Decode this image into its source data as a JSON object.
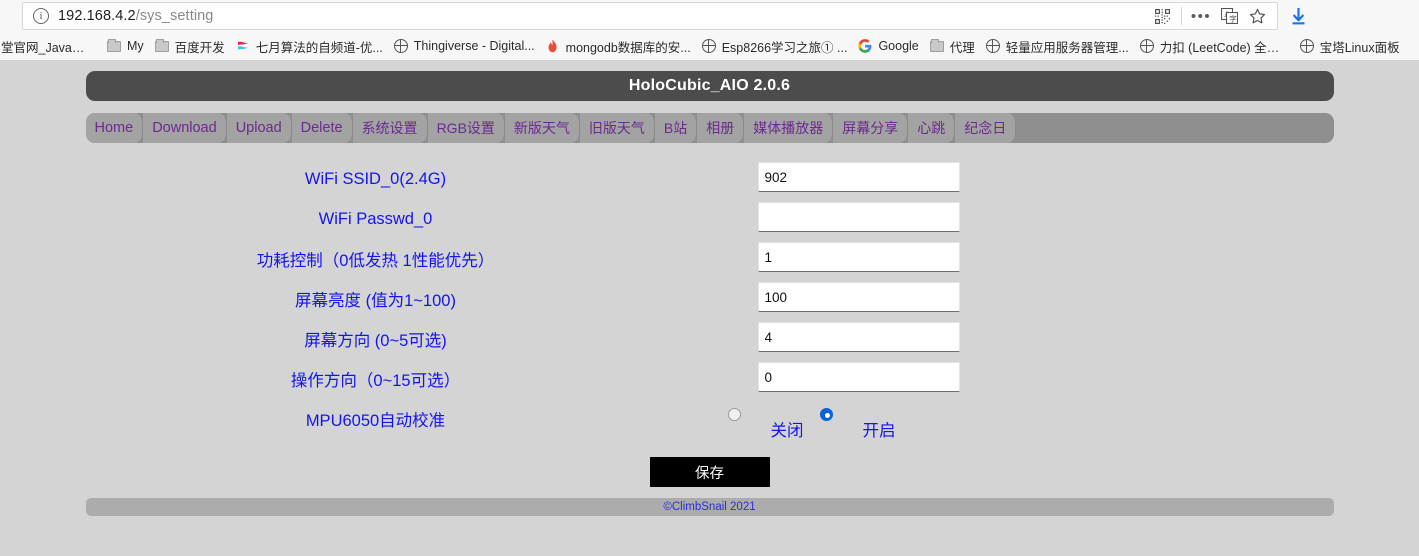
{
  "browser": {
    "url_host": "192.168.4.2",
    "url_path": "/sys_setting",
    "info_icon": "info-circle-icon",
    "toolbar_icons": {
      "qr": "qr-code-icon",
      "menu": "ellipsis-menu-icon",
      "translate": "translate-icon",
      "bookmark": "star-bookmark-icon",
      "download": "download-arrow-icon"
    },
    "bookmarks": [
      {
        "label": "堂官网_Java视频...",
        "icon": "page-icon"
      },
      {
        "label": "My",
        "icon": "folder-icon"
      },
      {
        "label": "百度开发",
        "icon": "folder-icon"
      },
      {
        "label": "七月算法的自频道-优...",
        "icon": "youku-icon"
      },
      {
        "label": "Thingiverse - Digital...",
        "icon": "globe-icon"
      },
      {
        "label": "mongodb数据库的安...",
        "icon": "flame-icon"
      },
      {
        "label": "Esp8266学习之旅① ...",
        "icon": "globe-icon"
      },
      {
        "label": "Google",
        "icon": "google-icon"
      },
      {
        "label": "代理",
        "icon": "folder-icon"
      },
      {
        "label": "轻量应用服务器管理...",
        "icon": "globe-icon"
      },
      {
        "label": "力扣 (LeetCode) 全球...",
        "icon": "globe-icon"
      },
      {
        "label": "宝塔Linux面板",
        "icon": "globe-icon"
      }
    ]
  },
  "page": {
    "title": "HoloCubic_AIO 2.0.6",
    "nav": [
      {
        "label": "Home",
        "cjk": false
      },
      {
        "label": "Download",
        "cjk": false
      },
      {
        "label": "Upload",
        "cjk": false
      },
      {
        "label": "Delete",
        "cjk": false
      },
      {
        "label": "系统设置",
        "cjk": true
      },
      {
        "label": "RGB设置",
        "cjk": true
      },
      {
        "label": "新版天气",
        "cjk": true
      },
      {
        "label": "旧版天气",
        "cjk": true
      },
      {
        "label": "B站",
        "cjk": true
      },
      {
        "label": "相册",
        "cjk": true
      },
      {
        "label": "媒体播放器",
        "cjk": true
      },
      {
        "label": "屏幕分享",
        "cjk": true
      },
      {
        "label": "心跳",
        "cjk": true
      },
      {
        "label": "纪念日",
        "cjk": true
      }
    ],
    "fields": [
      {
        "label": "WiFi SSID_0(2.4G)",
        "value": "902"
      },
      {
        "label": "WiFi Passwd_0",
        "value": ""
      },
      {
        "label": "功耗控制（0低发热 1性能优先）",
        "value": "1"
      },
      {
        "label": "屏幕亮度 (值为1~100)",
        "value": "100"
      },
      {
        "label": "屏幕方向 (0~5可选)",
        "value": "4"
      },
      {
        "label": "操作方向（0~15可选）",
        "value": "0"
      }
    ],
    "radio_group": {
      "label": "MPU6050自动校准",
      "options": [
        {
          "label": "关闭",
          "selected": false
        },
        {
          "label": "开启",
          "selected": true
        }
      ]
    },
    "save_label": "保存",
    "footer": "©ClimbSnail 2021",
    "colors": {
      "label_blue": "#1414f0",
      "nav_purple": "#6a2a8f",
      "title_bar": "#4c4c4c",
      "nav_bar": "#8f8f8f",
      "page_bg": "#d4d4d4",
      "footer_bar": "#acacac",
      "radio_on": "#0a63d6"
    }
  }
}
